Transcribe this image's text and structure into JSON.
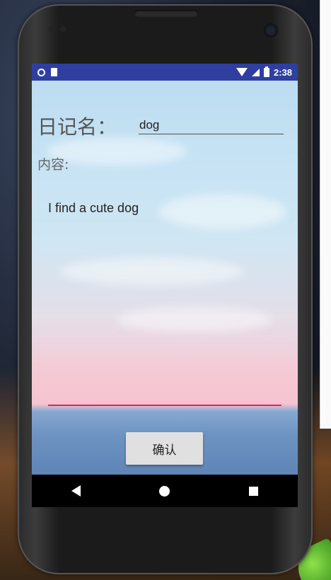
{
  "status_bar": {
    "time": "2:38",
    "icons": [
      "notification-circle-icon",
      "sd-card-icon",
      "wifi-icon",
      "signal-icon",
      "battery-charging-icon"
    ],
    "color": "#303f9f"
  },
  "form": {
    "title_label": "日记名：",
    "title_value": "dog",
    "content_label": "内容:",
    "content_value": "I find a cute dog",
    "accent_color": "#e91e63"
  },
  "actions": {
    "confirm_label": "确认"
  },
  "nav_bar": {
    "icons": [
      "back-icon",
      "home-icon",
      "recents-icon"
    ]
  }
}
